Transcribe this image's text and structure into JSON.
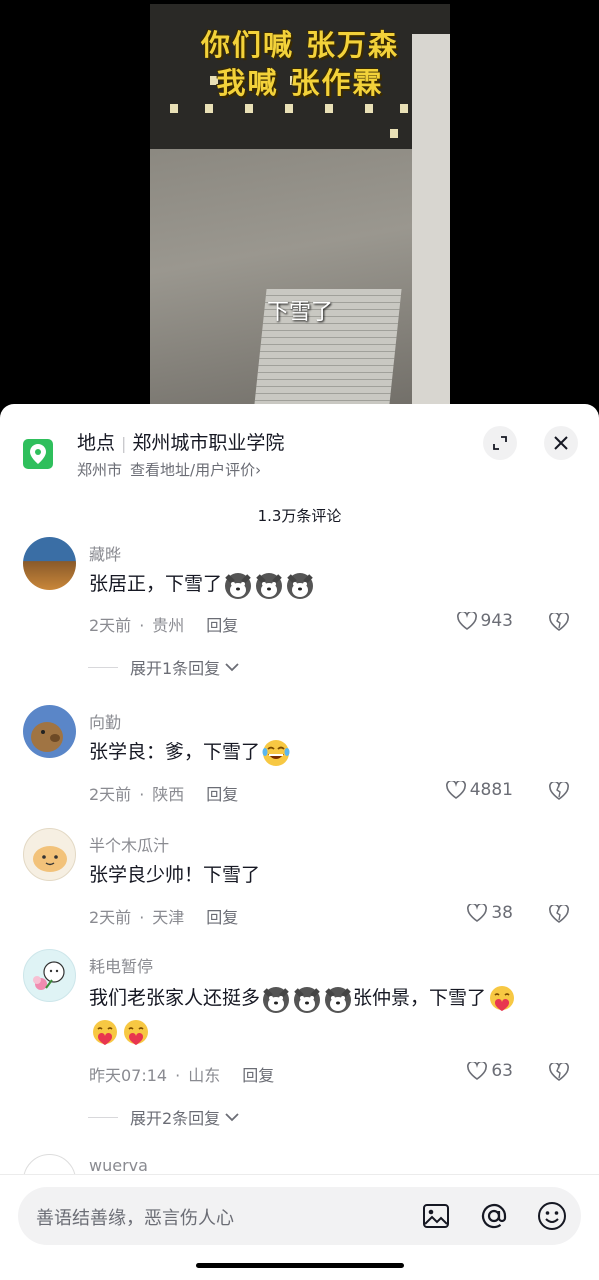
{
  "video": {
    "title_line1": "你们喊 张万森",
    "title_line2": "我喊 张作霖",
    "caption": "下雪了"
  },
  "location": {
    "label": "地点",
    "name": "郑州城市职业学院",
    "city": "郑州市",
    "link": "查看地址/用户评价",
    "chevron": "›"
  },
  "comment_count": "1.3万条评论",
  "comments": [
    {
      "user": "藏晔",
      "text": "张居正，下雪了",
      "emojis": [
        "husky-emoji",
        "husky-emoji",
        "husky-emoji"
      ],
      "time": "2天前",
      "region": "贵州",
      "reply": "回复",
      "likes": "943",
      "expand": "展开1条回复"
    },
    {
      "user": "向勤",
      "text": "张学良：爹，下雪了",
      "emojis": [
        "laugh-cry-emoji"
      ],
      "time": "2天前",
      "region": "陕西",
      "reply": "回复",
      "likes": "4881"
    },
    {
      "user": "半个木瓜汁",
      "text": "张学良少帅！下雪了",
      "time": "2天前",
      "region": "天津",
      "reply": "回复",
      "likes": "38"
    },
    {
      "user": "耗电暂停",
      "text_part1": "我们老张家人还挺多",
      "text_part2": "张仲景，下雪了",
      "time": "昨天07:14",
      "region": "山东",
      "reply": "回复",
      "likes": "63",
      "expand": "展开2条回复"
    },
    {
      "user": "wuerva"
    }
  ],
  "input": {
    "placeholder": "善语结善缘，恶言伤人心",
    "icons": [
      "image-icon",
      "at-icon",
      "emoji-icon"
    ]
  },
  "colors": {
    "location_green": "#2fbf5c",
    "video_title_yellow": "#f3d23a"
  }
}
